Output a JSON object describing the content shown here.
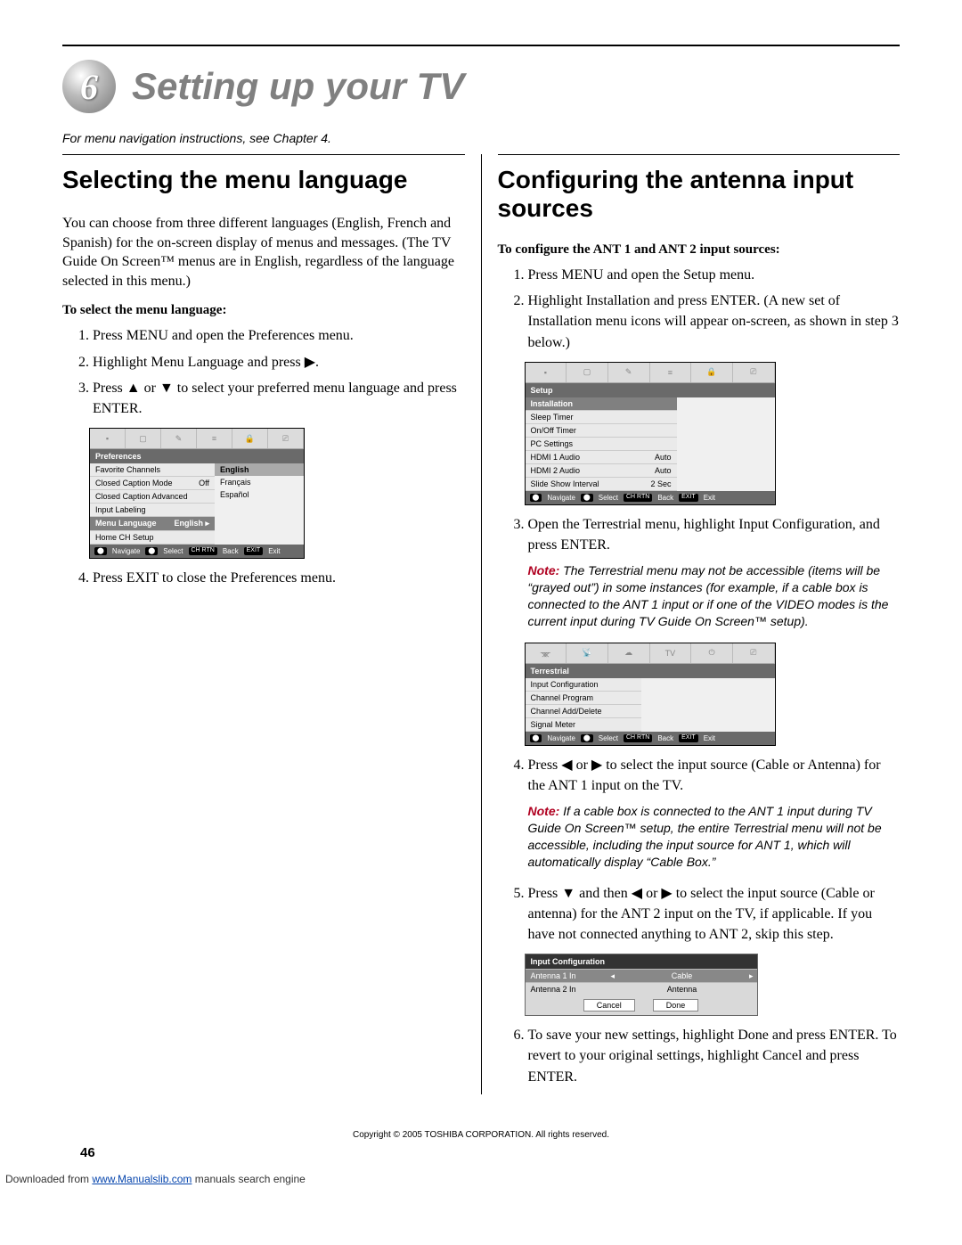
{
  "chapter": {
    "number": "6",
    "title": "Setting up your TV"
  },
  "intro_note": "For menu navigation instructions, see Chapter 4.",
  "left": {
    "heading": "Selecting the menu language",
    "para1": "You can choose from three different languages (English, French and Spanish) for the on-screen display of menus and messages. (The TV Guide On Screen™ menus are in English, regardless of the language selected in this menu.)",
    "sub_heading": "To select the menu language:",
    "steps": {
      "s1": "Press MENU and open the Preferences menu.",
      "s2_a": "Highlight Menu Language and press ",
      "s2_r": "▶",
      "s2_b": ".",
      "s3_a": "Press ",
      "s3_up": "▲",
      "s3_mid": " or ",
      "s3_dn": "▼",
      "s3_b": " to select your preferred menu language and press ENTER.",
      "s4": "Press EXIT to close the Preferences menu."
    },
    "osd": {
      "title": "Preferences",
      "rows": [
        {
          "label": "Favorite Channels",
          "val": ""
        },
        {
          "label": "Closed Caption Mode",
          "val": "Off"
        },
        {
          "label": "Closed Caption Advanced",
          "val": ""
        },
        {
          "label": "Input Labeling",
          "val": ""
        },
        {
          "label": "Menu Language",
          "val": "English ▸",
          "sel": true
        },
        {
          "label": "Home CH Setup",
          "val": ""
        }
      ],
      "side_opts": [
        "English",
        "Français",
        "Español"
      ],
      "side_hi": 0,
      "nav": [
        "Navigate",
        "Select",
        "Back",
        "Exit"
      ],
      "nav_keys": [
        "⬤",
        "⬤",
        "CH RTN",
        "EXIT"
      ]
    }
  },
  "right": {
    "heading": "Configuring the antenna input sources",
    "sub_heading": "To configure the ANT 1 and ANT 2 input sources:",
    "steps": {
      "s1": "Press MENU and open the Setup menu.",
      "s2": "Highlight Installation and press ENTER. (A new set of Installation menu icons will appear on-screen, as shown in step 3 below.)",
      "s3": "Open the Terrestrial menu, highlight Input Configuration, and press ENTER.",
      "s4_a": "Press ",
      "s4_l": "◀",
      "s4_mid1": " or ",
      "s4_r": "▶",
      "s4_b": " to select the input source (Cable or Antenna) for the ANT 1 input on the TV.",
      "s5_a": "Press ",
      "s5_dn": "▼",
      "s5_mid1": " and then ",
      "s5_l": "◀",
      "s5_mid2": " or ",
      "s5_r": "▶",
      "s5_b": " to select the input source (Cable or antenna) for the ANT 2 input on the TV, if applicable. If you have not connected anything to ANT 2, skip this step.",
      "s6": "To save your new settings, highlight Done and press ENTER. To revert to your original settings, highlight Cancel and press ENTER."
    },
    "note1_label": "Note:",
    "note1": " The Terrestrial menu may not be accessible (items will be “grayed out”) in some instances (for example, if a cable box is connected to the ANT 1 input or if one of the VIDEO modes is the current input during TV Guide On Screen™ setup).",
    "note2_label": "Note:",
    "note2": " If a cable box is connected to the ANT 1 input during TV Guide On Screen™ setup, the entire Terrestrial menu will not be accessible, including the input source for ANT 1, which will automatically display “Cable Box.”",
    "osd_setup": {
      "title": "Setup",
      "rows": [
        {
          "label": "Installation",
          "val": "",
          "sel": true
        },
        {
          "label": "Sleep Timer",
          "val": ""
        },
        {
          "label": "On/Off Timer",
          "val": ""
        },
        {
          "label": "PC Settings",
          "val": ""
        },
        {
          "label": "HDMI 1 Audio",
          "val": "Auto"
        },
        {
          "label": "HDMI 2 Audio",
          "val": "Auto"
        },
        {
          "label": "Slide Show Interval",
          "val": "2 Sec"
        }
      ],
      "nav": [
        "Navigate",
        "Select",
        "Back",
        "Exit"
      ],
      "nav_keys": [
        "⬤",
        "⬤",
        "CH RTN",
        "EXIT"
      ]
    },
    "osd_terr": {
      "title": "Terrestrial",
      "rows": [
        {
          "label": "Input Configuration",
          "val": ""
        },
        {
          "label": "Channel Program",
          "val": ""
        },
        {
          "label": "Channel Add/Delete",
          "val": ""
        },
        {
          "label": "Signal Meter",
          "val": ""
        }
      ],
      "nav": [
        "Navigate",
        "Select",
        "Back",
        "Exit"
      ],
      "nav_keys": [
        "⬤",
        "⬤",
        "CH RTN",
        "EXIT"
      ]
    },
    "inputcfg": {
      "title": "Input Configuration",
      "rows": [
        {
          "label": "Antenna 1 In",
          "val": "Cable",
          "sel": true,
          "arrows": true
        },
        {
          "label": "Antenna 2 In",
          "val": "Antenna"
        }
      ],
      "buttons": [
        "Cancel",
        "Done"
      ]
    }
  },
  "footer": {
    "copyright": "Copyright © 2005 TOSHIBA CORPORATION. All rights reserved.",
    "page": "46",
    "download_pre": "Downloaded from ",
    "download_link": "www.Manualslib.com",
    "download_post": " manuals search engine"
  }
}
